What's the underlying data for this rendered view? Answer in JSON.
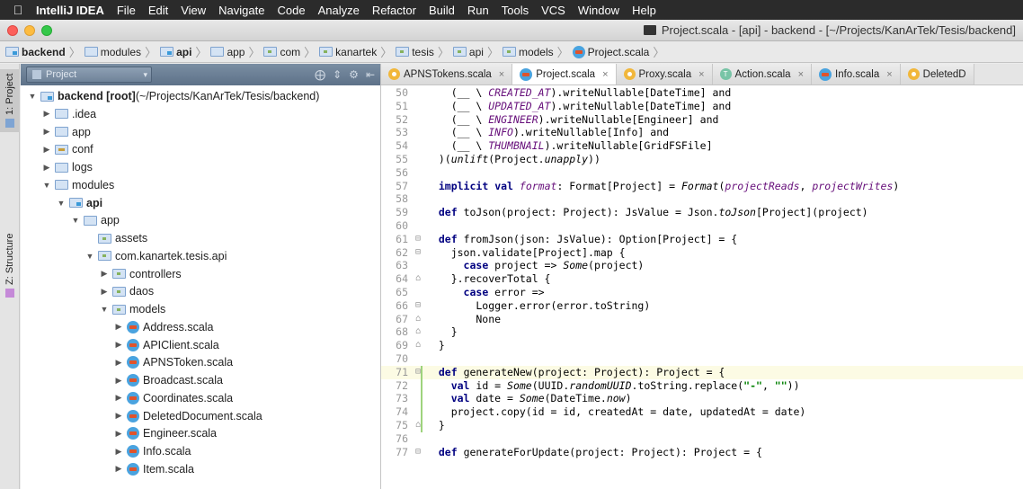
{
  "menubar": {
    "app": "IntelliJ IDEA",
    "items": [
      "File",
      "Edit",
      "View",
      "Navigate",
      "Code",
      "Analyze",
      "Refactor",
      "Build",
      "Run",
      "Tools",
      "VCS",
      "Window",
      "Help"
    ]
  },
  "window": {
    "title": "Project.scala - [api] - backend - [~/Projects/KanArTek/Tesis/backend]"
  },
  "breadcrumb": [
    "backend",
    "modules",
    "api",
    "app",
    "com",
    "kanartek",
    "tesis",
    "api",
    "models",
    "Project.scala"
  ],
  "toolstripe": {
    "project_tab": "1: Project",
    "structure_tab": "Z: Structure"
  },
  "project_panel": {
    "view_selector": "Project",
    "tree": [
      {
        "label": "backend [root] (~/Projects/KanArTek/Tesis/backend)",
        "bold_part": "backend [root]",
        "rest": " (~/Projects/KanArTek/Tesis/backend)",
        "depth": 0,
        "expanded": true,
        "icon": "module-folder"
      },
      {
        "label": ".idea",
        "depth": 1,
        "expanded": false,
        "icon": "folder"
      },
      {
        "label": "app",
        "depth": 1,
        "expanded": false,
        "icon": "folder"
      },
      {
        "label": "conf",
        "depth": 1,
        "expanded": false,
        "icon": "resource-folder"
      },
      {
        "label": "logs",
        "depth": 1,
        "expanded": false,
        "icon": "folder"
      },
      {
        "label": "modules",
        "depth": 1,
        "expanded": true,
        "icon": "folder"
      },
      {
        "label": "api",
        "depth": 2,
        "expanded": true,
        "icon": "module-folder",
        "bold": true
      },
      {
        "label": "app",
        "depth": 3,
        "expanded": true,
        "icon": "folder"
      },
      {
        "label": "assets",
        "depth": 4,
        "expanded": null,
        "icon": "package-folder"
      },
      {
        "label": "com.kanartek.tesis.api",
        "depth": 4,
        "expanded": true,
        "icon": "package-folder"
      },
      {
        "label": "controllers",
        "depth": 5,
        "expanded": false,
        "icon": "package-folder"
      },
      {
        "label": "daos",
        "depth": 5,
        "expanded": false,
        "icon": "package-folder"
      },
      {
        "label": "models",
        "depth": 5,
        "expanded": true,
        "icon": "package-folder"
      },
      {
        "label": "Address.scala",
        "depth": 6,
        "expanded": false,
        "icon": "scala-file"
      },
      {
        "label": "APIClient.scala",
        "depth": 6,
        "expanded": false,
        "icon": "scala-file"
      },
      {
        "label": "APNSToken.scala",
        "depth": 6,
        "expanded": false,
        "icon": "scala-file"
      },
      {
        "label": "Broadcast.scala",
        "depth": 6,
        "expanded": false,
        "icon": "scala-file"
      },
      {
        "label": "Coordinates.scala",
        "depth": 6,
        "expanded": false,
        "icon": "scala-file"
      },
      {
        "label": "DeletedDocument.scala",
        "depth": 6,
        "expanded": false,
        "icon": "scala-file"
      },
      {
        "label": "Engineer.scala",
        "depth": 6,
        "expanded": false,
        "icon": "scala-file"
      },
      {
        "label": "Info.scala",
        "depth": 6,
        "expanded": false,
        "icon": "scala-file"
      },
      {
        "label": "Item.scala",
        "depth": 6,
        "expanded": false,
        "icon": "scala-file"
      }
    ]
  },
  "tabs": [
    {
      "label": "APNSTokens.scala",
      "icon": "object",
      "active": false
    },
    {
      "label": "Project.scala",
      "icon": "scala",
      "active": true
    },
    {
      "label": "Proxy.scala",
      "icon": "object",
      "active": false
    },
    {
      "label": "Action.scala",
      "icon": "trait",
      "active": false
    },
    {
      "label": "Info.scala",
      "icon": "scala",
      "active": false
    },
    {
      "label": "DeletedD",
      "icon": "object",
      "active": false
    }
  ],
  "editor": {
    "current_line": 71,
    "lines": [
      {
        "n": 50,
        "fold": "",
        "code": "    (__ \\ CREATED_AT).writeNullable[DateTime] and"
      },
      {
        "n": 51,
        "fold": "",
        "code": "    (__ \\ UPDATED_AT).writeNullable[DateTime] and"
      },
      {
        "n": 52,
        "fold": "",
        "code": "    (__ \\ ENGINEER).writeNullable[Engineer] and"
      },
      {
        "n": 53,
        "fold": "",
        "code": "    (__ \\ INFO).writeNullable[Info] and"
      },
      {
        "n": 54,
        "fold": "",
        "code": "    (__ \\ THUMBNAIL).writeNullable[GridFSFile]"
      },
      {
        "n": 55,
        "fold": "",
        "code": "  )(unlift(Project.unapply))"
      },
      {
        "n": 56,
        "fold": "",
        "code": ""
      },
      {
        "n": 57,
        "fold": "",
        "code": "  implicit val format: Format[Project] = Format(projectReads, projectWrites)"
      },
      {
        "n": 58,
        "fold": "",
        "code": ""
      },
      {
        "n": 59,
        "fold": "",
        "code": "  def toJson(project: Project): JsValue = Json.toJson[Project](project)"
      },
      {
        "n": 60,
        "fold": "",
        "code": ""
      },
      {
        "n": 61,
        "fold": "open",
        "code": "  def fromJson(json: JsValue): Option[Project] = {"
      },
      {
        "n": 62,
        "fold": "open",
        "code": "    json.validate[Project].map {"
      },
      {
        "n": 63,
        "fold": "",
        "code": "      case project => Some(project)"
      },
      {
        "n": 64,
        "fold": "close",
        "code": "    }.recoverTotal {"
      },
      {
        "n": 65,
        "fold": "",
        "code": "      case error =>"
      },
      {
        "n": 66,
        "fold": "open",
        "code": "        Logger.error(error.toString)"
      },
      {
        "n": 67,
        "fold": "close",
        "code": "        None"
      },
      {
        "n": 68,
        "fold": "close",
        "code": "    }"
      },
      {
        "n": 69,
        "fold": "close",
        "code": "  }"
      },
      {
        "n": 70,
        "fold": "",
        "code": ""
      },
      {
        "n": 71,
        "fold": "open",
        "code": "  def generateNew(project: Project): Project = {"
      },
      {
        "n": 72,
        "fold": "",
        "code": "    val id = Some(UUID.randomUUID.toString.replace(\"-\", \"\"))"
      },
      {
        "n": 73,
        "fold": "",
        "code": "    val date = Some(DateTime.now)"
      },
      {
        "n": 74,
        "fold": "",
        "code": "    project.copy(id = id, createdAt = date, updatedAt = date)"
      },
      {
        "n": 75,
        "fold": "close",
        "code": "  }"
      },
      {
        "n": 76,
        "fold": "",
        "code": ""
      },
      {
        "n": 77,
        "fold": "open",
        "code": "  def generateForUpdate(project: Project): Project = {"
      }
    ]
  },
  "colors": {
    "menubar_bg": "#2b2b2b",
    "project_header": "#6a7f95",
    "keyword": "#000080",
    "string": "#008000",
    "current_line": "#fcfbe4"
  }
}
